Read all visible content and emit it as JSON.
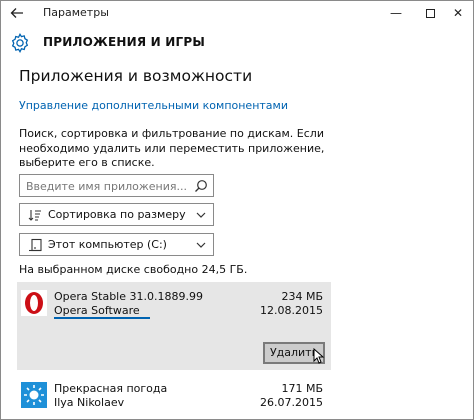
{
  "window": {
    "title": "Параметры",
    "back_icon": "back-arrow-icon",
    "minimize_label": "—",
    "close_label": "✕"
  },
  "header": {
    "icon": "gear-icon",
    "title": "ПРИЛОЖЕНИЯ И ИГРЫ"
  },
  "main": {
    "title": "Приложения и возможности",
    "manage_link": "Управление дополнительными компонентами",
    "description": "Поиск, сортировка и фильтрование по дискам. Если необходимо удалить или переместить приложение, выберите его в списке.",
    "search": {
      "placeholder": "Введите имя приложения...",
      "icon": "search-icon"
    },
    "sort_dropdown": {
      "icon": "sort-icon",
      "value": "Сортировка по размеру"
    },
    "drive_dropdown": {
      "icon": "drive-icon",
      "value": "Этот компьютер (C:)"
    },
    "free_space": "На выбранном диске свободно 24,5 ГБ."
  },
  "apps": [
    {
      "name": "Opera Stable 31.0.1889.99",
      "publisher": "Opera Software",
      "size": "234 МБ",
      "date": "12.08.2015",
      "icon": "opera-icon",
      "uninstall_label": "Удалить"
    },
    {
      "name": "Прекрасная погода",
      "publisher": "Ilya Nikolaev",
      "size": "171 МБ",
      "date": "26.07.2015",
      "icon": "weather-sun-icon"
    }
  ],
  "colors": {
    "accent": "#0063b1",
    "selected_bg": "#e6e6e6",
    "opera_red": "#cc0f16",
    "weather_blue": "#1e90d8"
  }
}
